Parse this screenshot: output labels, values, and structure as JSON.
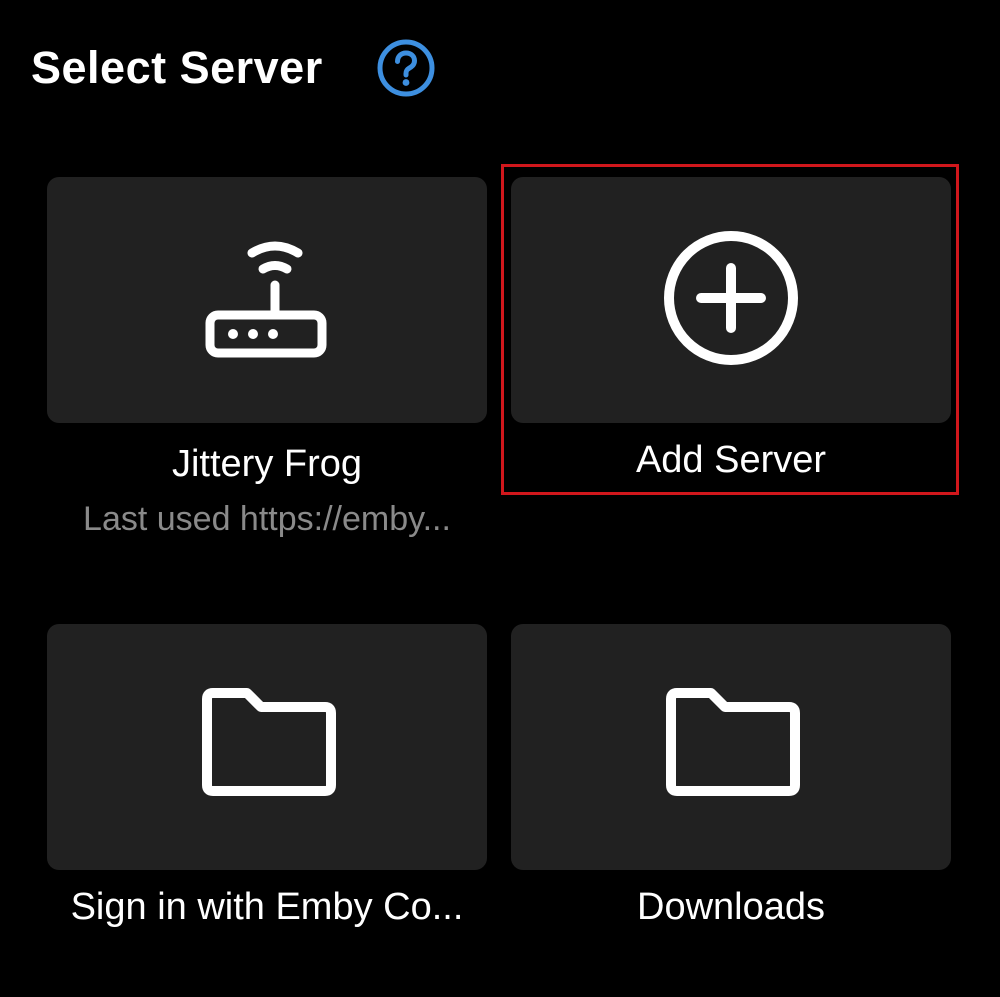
{
  "header": {
    "title": "Select Server",
    "help_icon": "help-circle-icon",
    "accent_color": "#3d8fe0"
  },
  "tiles": [
    {
      "label": "Jittery Frog",
      "sublabel": "Last used https://emby...",
      "icon": "router-icon"
    },
    {
      "label": "Add Server",
      "icon": "add-circle-icon",
      "highlighted": true
    },
    {
      "label": "Sign in with Emby Co...",
      "icon": "folder-icon"
    },
    {
      "label": "Downloads",
      "icon": "folder-icon"
    }
  ],
  "colors": {
    "background": "#000000",
    "card": "#212121",
    "highlight_border": "#d0171c",
    "secondary_text": "#8a8a8a"
  }
}
